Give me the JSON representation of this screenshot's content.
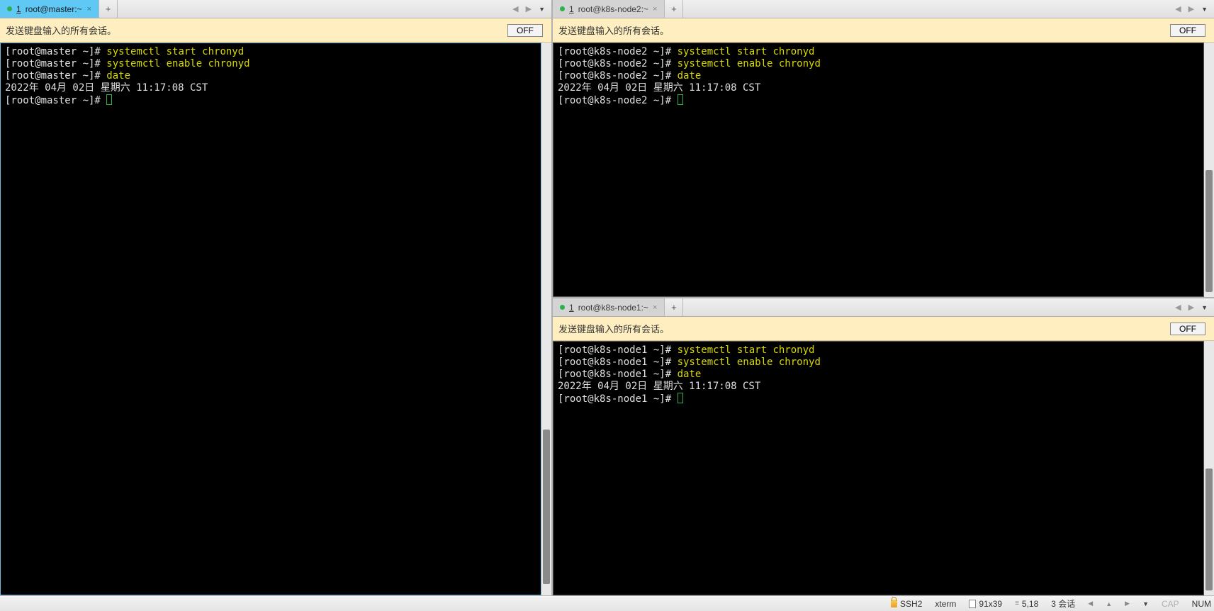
{
  "panes": {
    "left": {
      "tab": {
        "num": "1",
        "title": "root@master:~",
        "active": true
      },
      "banner": {
        "text": "发送键盘输入的所有会话。",
        "btn": "OFF"
      },
      "term": {
        "host": "master",
        "lines": [
          {
            "p": "[root@master ~]# ",
            "c": "systemctl start chronyd"
          },
          {
            "p": "[root@master ~]# ",
            "c": "systemctl enable chronyd"
          },
          {
            "p": "[root@master ~]# ",
            "c": "date"
          },
          {
            "out": "2022年 04月 02日 星期六 11:17:08 CST"
          },
          {
            "p": "[root@master ~]# ",
            "cursor": true
          }
        ]
      }
    },
    "topRight": {
      "tab": {
        "num": "1",
        "title": "root@k8s-node2:~",
        "active": false
      },
      "banner": {
        "text": "发送键盘输入的所有会话。",
        "btn": "OFF"
      },
      "term": {
        "host": "k8s-node2",
        "lines": [
          {
            "p": "[root@k8s-node2 ~]# ",
            "c": "systemctl start chronyd"
          },
          {
            "p": "[root@k8s-node2 ~]# ",
            "c": "systemctl enable chronyd"
          },
          {
            "p": "[root@k8s-node2 ~]# ",
            "c": "date"
          },
          {
            "out": "2022年 04月 02日 星期六 11:17:08 CST"
          },
          {
            "p": "[root@k8s-node2 ~]# ",
            "cursor": true
          }
        ]
      }
    },
    "bottomRight": {
      "tab": {
        "num": "1",
        "title": "root@k8s-node1:~",
        "active": false
      },
      "banner": {
        "text": "发送键盘输入的所有会话。",
        "btn": "OFF"
      },
      "term": {
        "host": "k8s-node1",
        "lines": [
          {
            "p": "[root@k8s-node1 ~]# ",
            "c": "systemctl start chronyd"
          },
          {
            "p": "[root@k8s-node1 ~]# ",
            "c": "systemctl enable chronyd"
          },
          {
            "p": "[root@k8s-node1 ~]# ",
            "c": "date"
          },
          {
            "out": "2022年 04月 02日 星期六 11:17:08 CST"
          },
          {
            "p": "[root@k8s-node1 ~]# ",
            "cursor": true
          }
        ]
      }
    }
  },
  "status": {
    "proto": "SSH2",
    "termType": "xterm",
    "size": "91x39",
    "pos": "5,18",
    "sessions": "3 会话",
    "cap": "CAP",
    "num": "NUM"
  },
  "icons": {
    "plus": "+",
    "close": "×",
    "left": "◀",
    "right": "▶",
    "down": "▼",
    "up": "▲"
  }
}
